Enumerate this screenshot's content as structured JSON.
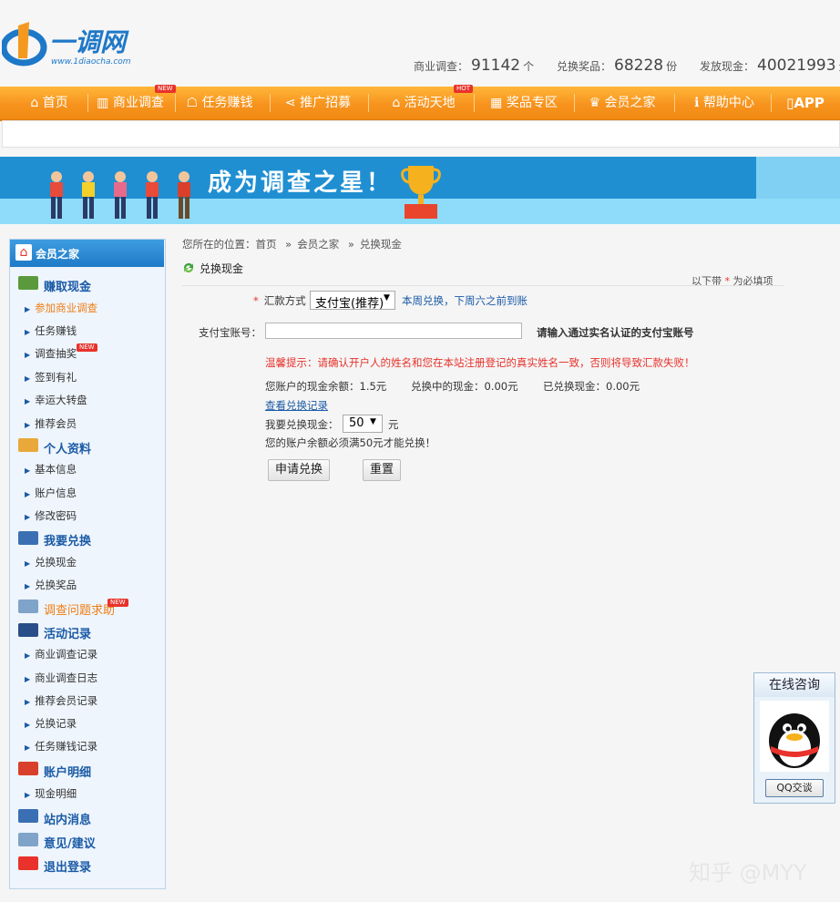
{
  "site": {
    "logo_text": "一调网",
    "logo_url_text": "www.1diaocha.com"
  },
  "stats": [
    {
      "label": "商业调查：",
      "value": "91142",
      "unit": "个"
    },
    {
      "label": "兑换奖品：",
      "value": "68228",
      "unit": "份"
    },
    {
      "label": "发放现金：",
      "value": "40021993",
      "unit": "元"
    }
  ],
  "nav": {
    "items": [
      {
        "label": "首页",
        "icon": "home-icon"
      },
      {
        "label": "商业调查",
        "icon": "chart-icon",
        "badge": "NEW"
      },
      {
        "label": "任务赚钱",
        "icon": "task-icon"
      },
      {
        "label": "推广招募",
        "icon": "share-icon"
      },
      {
        "label": "活动天地",
        "icon": "event-icon",
        "badge": "HOT"
      },
      {
        "label": "奖品专区",
        "icon": "gift-icon"
      },
      {
        "label": "会员之家",
        "icon": "crown-icon"
      },
      {
        "label": "帮助中心",
        "icon": "help-icon"
      },
      {
        "label": "APP",
        "icon": "phone-icon"
      }
    ]
  },
  "banner": {
    "slogan": "成为调查之星！"
  },
  "sidebar": {
    "header": "会员之家",
    "sections": [
      {
        "title": "赚取现金",
        "items": [
          "参加商业调查",
          "任务赚钱",
          "调查抽奖",
          "签到有礼",
          "幸运大转盘",
          "推荐会员"
        ]
      },
      {
        "title": "个人资料",
        "items": [
          "基本信息",
          "账户信息",
          "修改密码"
        ]
      },
      {
        "title": "我要兑换",
        "items": [
          "兑换现金",
          "兑换奖品"
        ]
      },
      {
        "title": "调查问题求助",
        "items": []
      },
      {
        "title": "活动记录",
        "items": [
          "商业调查记录",
          "商业调查日志",
          "推荐会员记录",
          "兑换记录",
          "任务赚钱记录"
        ]
      },
      {
        "title": "账户明细",
        "items": [
          "现金明细"
        ]
      },
      {
        "title": "站内消息",
        "items": []
      },
      {
        "title": "意见/建议",
        "items": []
      },
      {
        "title": "退出登录",
        "items": []
      }
    ],
    "new_badge": "NEW"
  },
  "breadcrumb": {
    "prefix": "您所在的位置：",
    "items": [
      "首页",
      "会员之家",
      "兑换现金"
    ],
    "sep": "»"
  },
  "page": {
    "title": "兑换现金",
    "required_note_a": "以下带",
    "required_star": "*",
    "required_note_b": "为必填项"
  },
  "form": {
    "method_label": "汇款方式",
    "method_value": "支付宝(推荐)",
    "method_note": "本周兑换，下周六之前到账",
    "account_label": "支付宝账号：",
    "account_value": "",
    "account_hint": "请输入通过实名认证的支付宝账号",
    "warning": "温馨提示：请确认开户人的姓名和您在本站注册登记的真实姓名一致，否则将导致汇款失败！",
    "balance": "您账户的现金余额：1.5元",
    "pending": "兑换中的现金：0.00元",
    "exchanged": "已兑换现金：0.00元",
    "records_link": "查看兑换记录",
    "amount_label": "我要兑换现金：",
    "amount_value": "50",
    "amount_unit": "元",
    "min_note": "您的账户余额必须满50元才能兑换！",
    "submit": "申请兑换",
    "reset": "重置"
  },
  "consult": {
    "title": "在线咨询",
    "button": "QQ交谈"
  },
  "watermark": "知乎 @MYY",
  "colors": {
    "nav_orange": "#f7931e",
    "link_blue": "#1a5aa6",
    "warning_red": "#e8322b",
    "active_orange": "#f07d12"
  }
}
